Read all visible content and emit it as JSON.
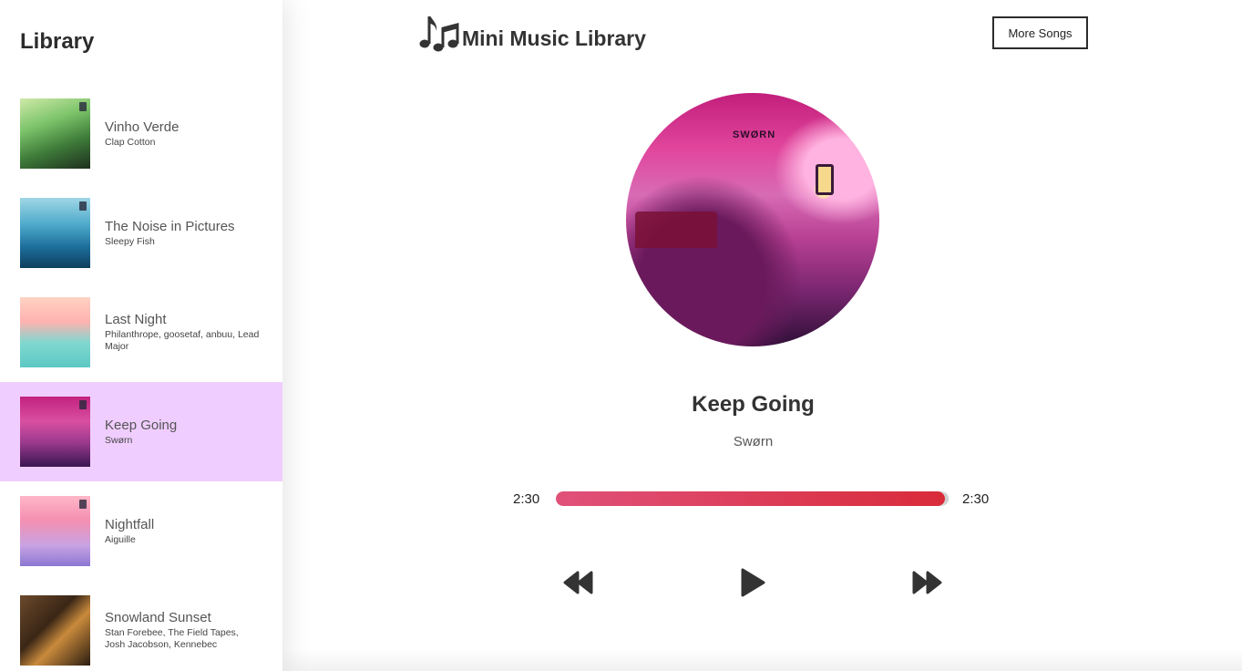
{
  "sidebar": {
    "title": "Library",
    "songs": [
      {
        "name": "Vinho Verde",
        "artist": "Clap Cotton",
        "active": false
      },
      {
        "name": "The Noise in Pictures",
        "artist": "Sleepy Fish",
        "active": false
      },
      {
        "name": "Last Night",
        "artist": "Philanthrope, goosetaf, anbuu, Lead Major",
        "active": false
      },
      {
        "name": "Keep Going",
        "artist": "Swørn",
        "active": true
      },
      {
        "name": "Nightfall",
        "artist": "Aiguille",
        "active": false
      },
      {
        "name": "Snowland Sunset",
        "artist": "Stan Forebee, The Field Tapes, Josh Jacobson, Kennebec",
        "active": false
      }
    ]
  },
  "header": {
    "title": "Mini Music Library",
    "logo_icon": "music-notes-icon",
    "more_button": "More Songs"
  },
  "player": {
    "art_text": "SWØRN",
    "track_title": "Keep Going",
    "track_artist": "Swørn",
    "current_time": "2:30",
    "duration": "2:30",
    "progress": 0.99,
    "controls": {
      "prev_icon": "skip-back-icon",
      "play_icon": "play-icon",
      "next_icon": "skip-forward-icon"
    }
  },
  "colors": {
    "active_item": "#f0cdff",
    "progress_start": "#e0517a",
    "progress_end": "#d92b3a"
  }
}
